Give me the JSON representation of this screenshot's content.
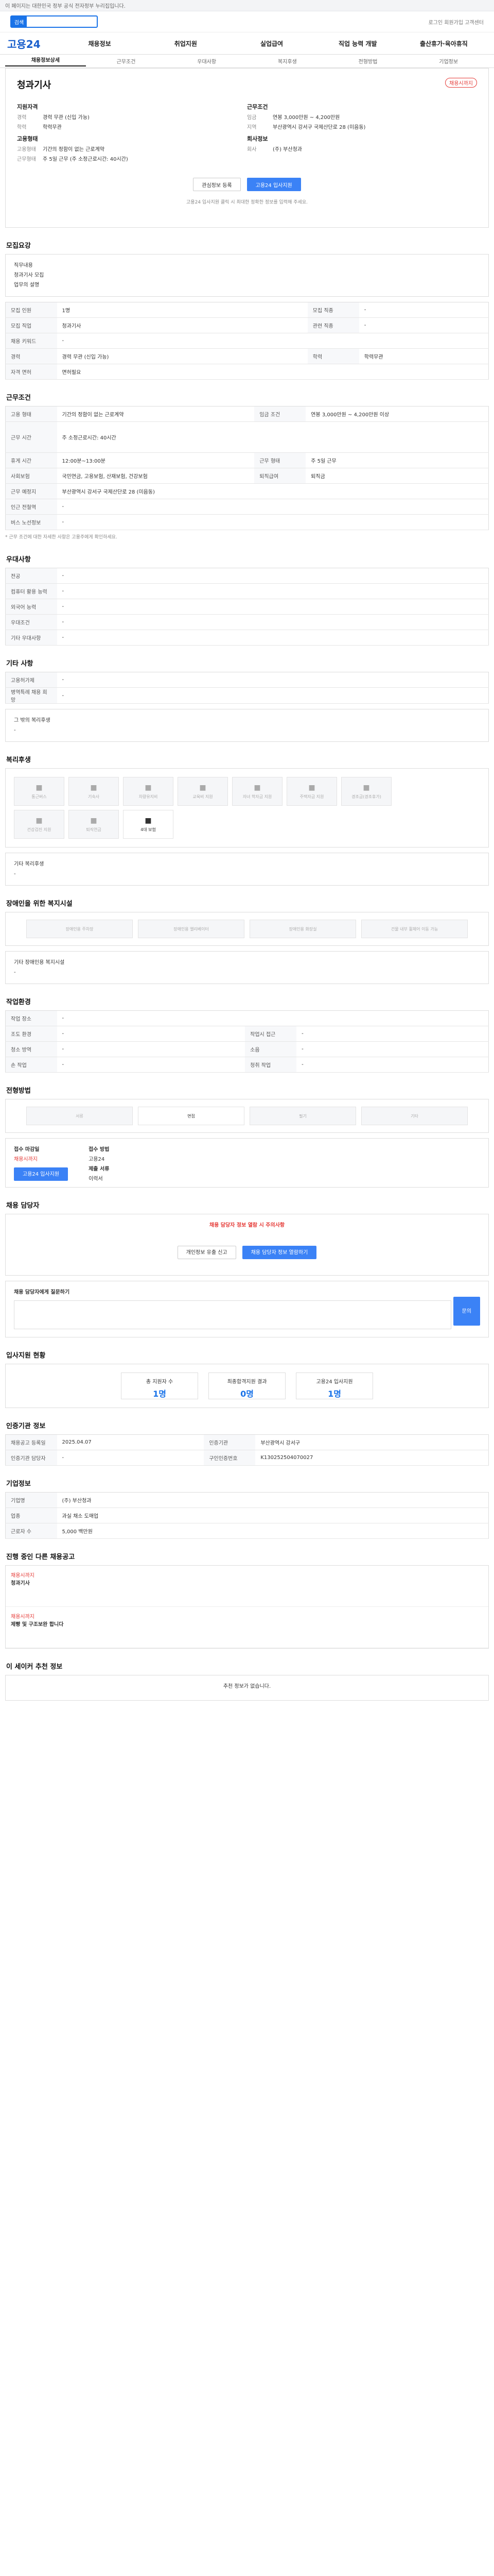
{
  "topbar": {
    "text": "이 페이지는 대한민국 정부 공식 전자정부 누리집입니다."
  },
  "header": {
    "search_label": "검색",
    "links": "로그인  회원가입  고객센터"
  },
  "gnb": {
    "logo": "고용24",
    "items": [
      "채용정보",
      "취업지원",
      "실업급여",
      "직업 능력 개발",
      "출산휴가·육아휴직"
    ]
  },
  "tabs": [
    "채용정보상세",
    "근무조건",
    "우대사항",
    "복지후생",
    "전형방법",
    "기업정보"
  ],
  "job": {
    "badge": "채용시까지",
    "title": "청과기사",
    "left_title": "지원자격",
    "left_kv": [
      [
        "경력",
        "경력 무관 (신입 가능)"
      ],
      [
        "학력",
        "학력무관"
      ]
    ],
    "left_title2": "고용형태",
    "left_kv2": [
      [
        "고용형태",
        "기간의 정함이 없는 근로계약"
      ],
      [
        "근무형태",
        "주 5일 근무 (주 소정근로시간: 40시간)"
      ]
    ],
    "right_title": "근무조건",
    "right_kv": [
      [
        "임금",
        "연봉 3,000만원 ~ 4,200만원"
      ],
      [
        "지역",
        "부산광역시 강서구 국제산단로 28 (미음동)"
      ]
    ],
    "right_title2": "회사정보",
    "right_kv2": [
      [
        "회사",
        "(주) 부산청과"
      ]
    ],
    "btn_save": "관심정보 등록",
    "btn_apply": "고용24 입사지원",
    "note": "고용24 입사지원 클릭 시 최대한 정확한 정보를 입력해 주세요."
  },
  "recruit": {
    "title": "모집요강",
    "body": [
      "직무내용",
      "청과기사 모집",
      "업무의 설명"
    ],
    "rows": [
      [
        "모집 인원",
        "1명",
        "모집 직종",
        "-"
      ],
      [
        "모집 직업",
        "청과기사",
        "관련 직종",
        "-"
      ],
      [
        "채용 키워드",
        "-",
        "",
        ""
      ],
      [
        "경력",
        "경력 무관 (신입 가능)",
        "학력",
        "학력무관"
      ],
      [
        "자격 면허",
        "면허필요",
        "",
        ""
      ]
    ]
  },
  "cond": {
    "title": "근무조건",
    "rows": [
      [
        "고용 형태",
        "기간의 정함이 없는 근로계약",
        "임금 조건",
        "연봉 3,000만원 ~ 4,200만원 이상"
      ],
      [
        "근무 시간",
        "주 소정근로시간: 40시간",
        "",
        ""
      ],
      [
        "휴게 시간",
        "12:00분~13:00분",
        "근무 형태",
        "주 5일 근무"
      ],
      [
        "사회보험",
        "국민연금, 고용보험, 산재보험, 건강보험",
        "퇴직급여",
        "퇴직금"
      ],
      [
        "근무 예정지",
        "부산광역시 강서구 국제산단로 28 (미음동)",
        "",
        ""
      ],
      [
        "인근 전철역",
        "-",
        "",
        ""
      ],
      [
        "버스 노선정보",
        "-",
        "",
        ""
      ]
    ],
    "note": "* 근무 조건에 대한 자세한 사항은 고용주에게 확인하세요."
  },
  "pref": {
    "title": "우대사항",
    "rows": [
      [
        "전공",
        "-"
      ],
      [
        "컴퓨터 활용 능력",
        "-"
      ],
      [
        "외국어 능력",
        "-"
      ],
      [
        "우대조건",
        "-"
      ],
      [
        "기타 우대사항",
        "-"
      ]
    ]
  },
  "etc": {
    "title": "기타 사항",
    "rows": [
      [
        "고용허가제",
        "-"
      ],
      [
        "병역특례 채용 희망",
        "-"
      ]
    ],
    "extra_label": "그 밖의 복리후생",
    "extra": "-"
  },
  "welfare": {
    "title": "복리후생",
    "items": [
      "통근버스",
      "기숙사",
      "차량유지비",
      "교육비 지원",
      "자녀 학자금 지원",
      "주택자금 지원",
      "경조금(경조휴가)",
      "건강검진 지원",
      "퇴직연금",
      "4대 보험"
    ],
    "extra_label": "기타 복리후생",
    "extra": "-"
  },
  "disabled": {
    "title": "장애인을 위한 복지시설",
    "items": [
      "장애인용 주차장",
      "장애인용 엘리베이터",
      "장애인용 화장실",
      "건물 내부 휠체어 이동 가능"
    ],
    "extra_label": "기타 장애인용 복지시설",
    "extra": "-"
  },
  "worksite": {
    "title": "작업환경",
    "rows": [
      [
        "작업 장소",
        "-",
        "",
        ""
      ],
      [
        "조도 환경",
        "-",
        "작업시 접근",
        "-"
      ],
      [
        "청소 방역",
        "-",
        "소음",
        "-"
      ],
      [
        "손 작업",
        "-",
        "청취 작업",
        "-"
      ]
    ]
  },
  "process": {
    "title": "전형방법",
    "steps": [
      "서류",
      "면접",
      "필기",
      "기타"
    ],
    "apply_title": "접수 마감일",
    "apply_value": "채용시까지",
    "apply_btn": "고용24 입사지원",
    "method_title": "접수 방법",
    "method_value": "고용24",
    "docs_title": "제출 서류",
    "docs_value": "이력서"
  },
  "contact": {
    "title": "채용 담당자",
    "warn": "채용 담당자 정보 열람 시 주의사항",
    "btn_view": "채용 담당자 정보 열람하기",
    "btn_report": "개인정보 유출 신고",
    "inquiry_title": "채용 담당자에게 질문하기",
    "inquiry_btn": "문의"
  },
  "stat": {
    "title": "입사지원 현황",
    "items": [
      [
        "총 지원자 수",
        "1명"
      ],
      [
        "최종합격지원 결과",
        "0명"
      ],
      [
        "고용24 입사지원",
        "1명"
      ]
    ]
  },
  "org": {
    "title": "인증기관 정보",
    "rows": [
      [
        "채용공고 등록일",
        "2025.04.07",
        "인증기관",
        "부산광역시 강서구"
      ],
      [
        "인증기관 담당자",
        "-",
        "구인인증번호",
        "K130252504070027"
      ]
    ]
  },
  "company": {
    "title": "기업정보",
    "rows": [
      [
        "기업명",
        "(주) 부산청과"
      ],
      [
        "업종",
        "과실 채소 도매업"
      ],
      [
        "근로자 수",
        "5,000 백만원"
      ]
    ]
  },
  "recommend": {
    "title": "진행 중인 다른 채용공고",
    "items": [
      {
        "name": "채용시까지",
        "title": "청과기사"
      },
      {
        "name": "채용시까지",
        "title": "제빵 및 구조보완 합니다"
      }
    ]
  },
  "recruit_bottom": {
    "title": "이 세이커 추천 정보",
    "empty": "추천 정보가 없습니다."
  }
}
